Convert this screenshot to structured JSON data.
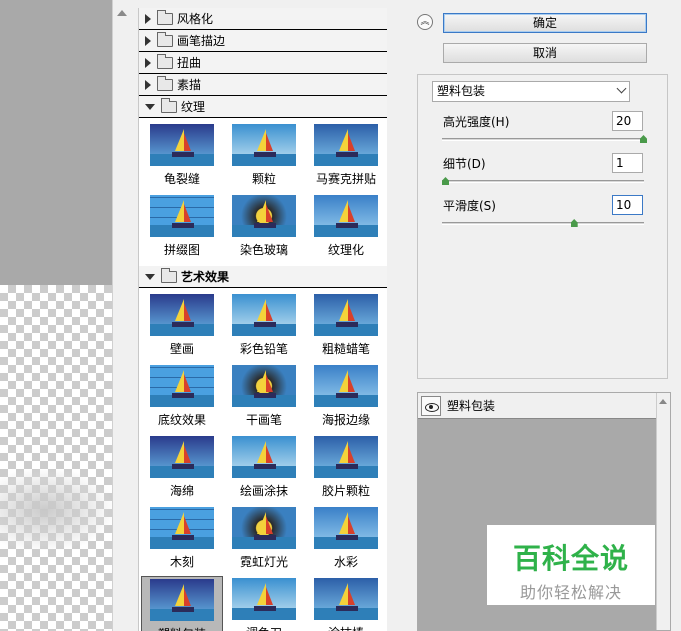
{
  "gallery": {
    "collapsed_categories": [
      {
        "label": "风格化"
      },
      {
        "label": "画笔描边"
      },
      {
        "label": "扭曲"
      },
      {
        "label": "素描"
      }
    ],
    "texture": {
      "label": "纹理",
      "filters": [
        "龟裂缝",
        "颗粒",
        "马赛克拼贴",
        "拼缀图",
        "染色玻璃",
        "纹理化"
      ]
    },
    "artistic": {
      "label": "艺术效果",
      "filters": [
        "壁画",
        "彩色铅笔",
        "粗糙蜡笔",
        "底纹效果",
        "干画笔",
        "海报边缘",
        "海绵",
        "绘画涂抹",
        "胶片颗粒",
        "木刻",
        "霓虹灯光",
        "水彩",
        "塑料包装",
        "调色刀",
        "涂抹棒"
      ],
      "selected": "塑料包装"
    }
  },
  "dialog": {
    "ok_label": "确定",
    "cancel_label": "取消",
    "collapse_icon": "double-chevron-up-icon"
  },
  "params": {
    "filter_select": "塑料包装",
    "highlight_strength": {
      "label": "高光强度(H)",
      "value": "20",
      "level": 1.0
    },
    "detail": {
      "label": "细节(D)",
      "value": "1",
      "level": 0.0
    },
    "smoothness": {
      "label": "平滑度(S)",
      "value": "10",
      "level": 0.65
    }
  },
  "layers": {
    "name": "塑料包装"
  },
  "watermark": {
    "title": "百科全说",
    "subtitle": "助你轻松解决"
  },
  "colors": {
    "slider_thumb": "#4a9a4a",
    "watermark_green": "#2fb24a",
    "focus_border": "#3b79c6"
  }
}
